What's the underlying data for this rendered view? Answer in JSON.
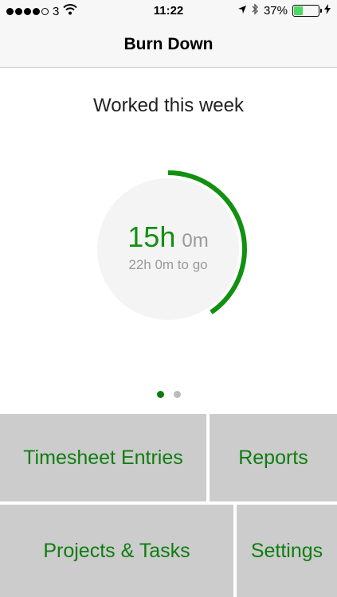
{
  "status_bar": {
    "carrier": "3",
    "time": "11:22",
    "battery_percent_label": "37%",
    "battery_level": 0.37,
    "icons": [
      "signal-dots-icon",
      "wifi-icon",
      "location-arrow-icon",
      "bluetooth-icon",
      "battery-icon",
      "charging-bolt-icon"
    ]
  },
  "nav": {
    "title": "Burn Down"
  },
  "summary": {
    "heading": "Worked this week",
    "hours": "15h",
    "minutes": "0m",
    "remaining": "22h 0m to go",
    "progress_fraction": 0.405
  },
  "pager": {
    "count": 2,
    "active_index": 0
  },
  "menu": {
    "timesheet": "Timesheet Entries",
    "reports": "Reports",
    "projects": "Projects & Tasks",
    "settings": "Settings"
  },
  "colors": {
    "accent": "#119011",
    "tile_bg": "#cccccc",
    "muted_text": "#9a9a9a",
    "ring_bg": "#f4f4f4"
  }
}
